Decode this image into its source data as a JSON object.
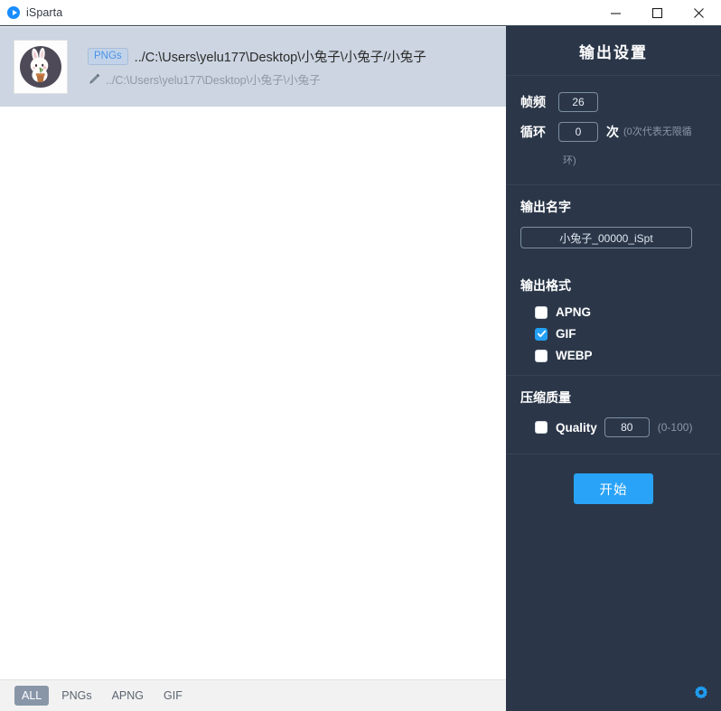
{
  "window": {
    "app_title": "iSparta",
    "logo_icon": "play-circle-icon",
    "minimize_icon": "minimize-icon",
    "maximize_icon": "maximize-icon",
    "close_icon": "close-icon"
  },
  "file_list": {
    "items": [
      {
        "thumbnail_icon": "rabbit-avatar-thumbnail",
        "type_badge": "PNGs",
        "source_path": "../C:\\Users\\yelu177\\Desktop\\小兔子\\小兔子/小兔子",
        "edit_icon": "pencil-icon",
        "output_path": "../C:\\Users\\yelu177\\Desktop\\小兔子\\小兔子",
        "selected": true
      }
    ]
  },
  "settings": {
    "header_title": "输出设置",
    "basic": {
      "framerate_label": "帧频",
      "framerate_value": "26",
      "loop_label": "循环",
      "loop_value": "0",
      "loop_unit": "次",
      "loop_hint": "(0次代表无限循",
      "loop_hint_2": "环)"
    },
    "output_name": {
      "title": "输出名字",
      "value": "小兔子_00000_iSpt"
    },
    "output_format": {
      "title": "输出格式",
      "options": [
        {
          "label": "APNG",
          "checked": false
        },
        {
          "label": "GIF",
          "checked": true
        },
        {
          "label": "WEBP",
          "checked": false
        }
      ]
    },
    "quality": {
      "title": "压缩质量",
      "checkbox_label": "Quality",
      "checked": false,
      "value": "80",
      "range_hint": "(0-100)"
    },
    "start_button": "开始",
    "gear_icon": "gear-icon"
  },
  "bottom_bar": {
    "tabs": [
      {
        "label": "ALL",
        "active": true
      },
      {
        "label": "PNGs",
        "active": false
      },
      {
        "label": "APNG",
        "active": false
      },
      {
        "label": "GIF",
        "active": false
      }
    ]
  },
  "colors": {
    "panel_bg": "#2b3749",
    "accent_blue": "#29a3f7",
    "selected_row": "#ccd5e1",
    "bottom_bar": "#f2f2f2"
  }
}
